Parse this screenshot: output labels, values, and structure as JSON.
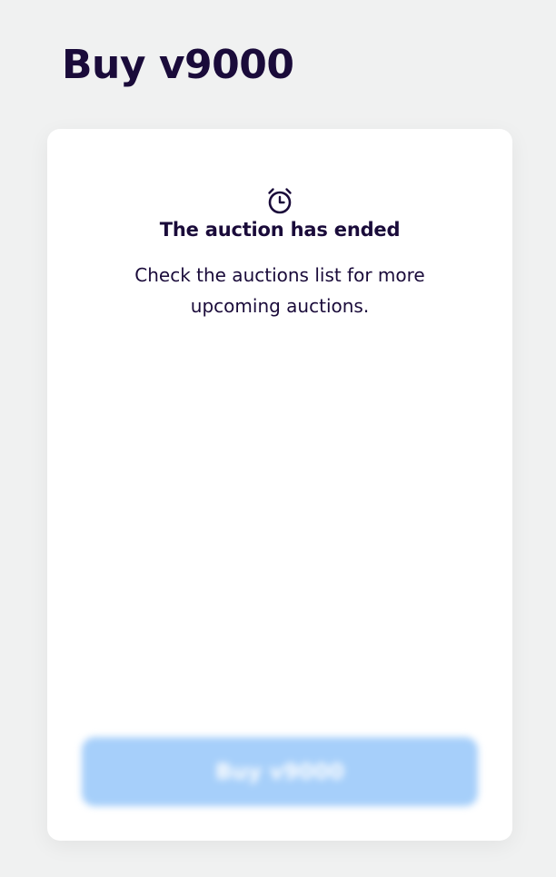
{
  "page": {
    "title": "Buy v9000"
  },
  "auction_status": {
    "icon": "alarm-clock-icon",
    "title": "The auction has ended",
    "message": "Check the auctions list for more upcoming auctions."
  },
  "buy_button": {
    "label": "Buy v9000",
    "state": "disabled"
  },
  "colors": {
    "background": "#f0f1f1",
    "card": "#ffffff",
    "text": "#1a0b3a",
    "button_disabled": "#a6cffa"
  }
}
